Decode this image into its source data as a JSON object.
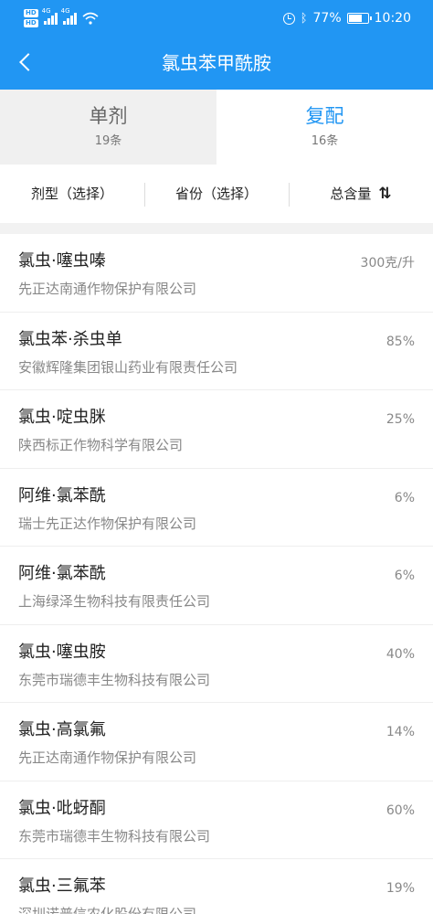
{
  "status_bar": {
    "network": "4G",
    "battery": "77%",
    "battery_level": 0.77,
    "time": "10:20",
    "icons": [
      "hd-icon",
      "signal-icon",
      "wifi-icon",
      "alarm-icon",
      "bluetooth-icon",
      "battery-icon"
    ]
  },
  "header": {
    "title": "氯虫苯甲酰胺",
    "back_icon": "chevron-left-icon"
  },
  "tabs": [
    {
      "label": "单剂",
      "count": "19条",
      "active": false
    },
    {
      "label": "复配",
      "count": "16条",
      "active": true
    }
  ],
  "filters": {
    "formulation": "剂型（选择）",
    "province": "省份（选择）",
    "content": "总含量",
    "sort_icon": "sort-icon"
  },
  "colors": {
    "primary": "#2196f3",
    "text": "#222222",
    "secondary": "#888888"
  },
  "items": [
    {
      "name": "氯虫·噻虫嗪",
      "company": "先正达南通作物保护有限公司",
      "content": "300克/升"
    },
    {
      "name": "氯虫苯·杀虫单",
      "company": "安徽辉隆集团银山药业有限责任公司",
      "content": "85%"
    },
    {
      "name": "氯虫·啶虫脒",
      "company": "陕西标正作物科学有限公司",
      "content": "25%"
    },
    {
      "name": "阿维·氯苯酰",
      "company": "瑞士先正达作物保护有限公司",
      "content": "6%"
    },
    {
      "name": "阿维·氯苯酰",
      "company": "上海绿泽生物科技有限责任公司",
      "content": "6%"
    },
    {
      "name": "氯虫·噻虫胺",
      "company": "东莞市瑞德丰生物科技有限公司",
      "content": "40%"
    },
    {
      "name": "氯虫·高氯氟",
      "company": "先正达南通作物保护有限公司",
      "content": "14%"
    },
    {
      "name": "氯虫·吡蚜酮",
      "company": "东莞市瑞德丰生物科技有限公司",
      "content": "60%"
    },
    {
      "name": "氯虫·三氟苯",
      "company": "深圳诺普信农化股份有限公司",
      "content": "19%"
    }
  ]
}
